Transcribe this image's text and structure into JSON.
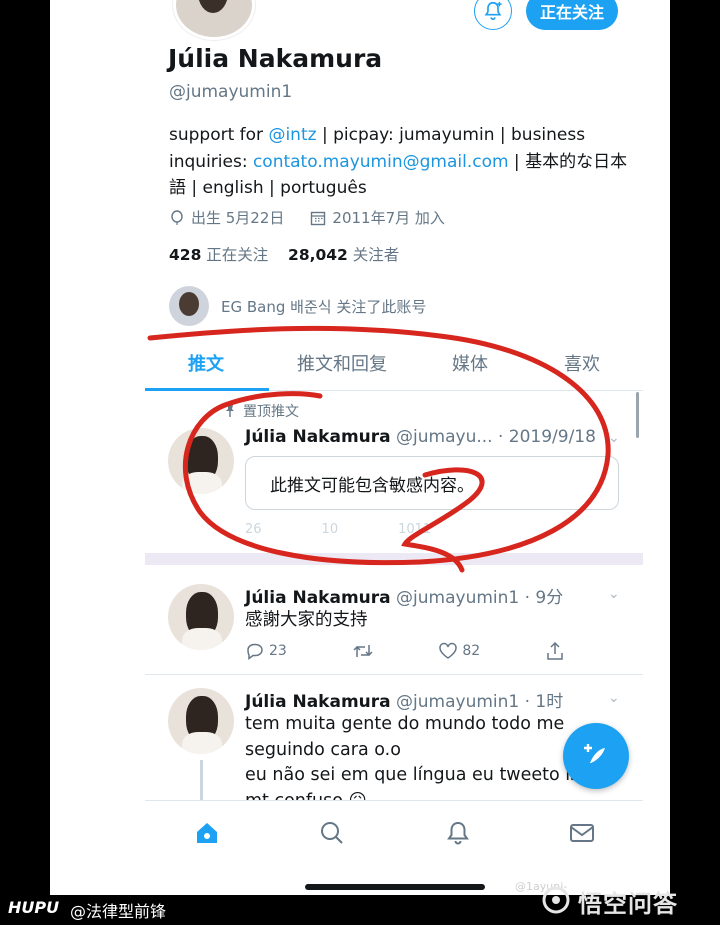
{
  "profile": {
    "follow_label": "正在关注",
    "name": "Júlia Nakamura",
    "handle": "@jumayumin1",
    "bio_parts": {
      "p1": "support for ",
      "link1": "@intz",
      "p2": " | picpay: jumayumin | business inquiries: ",
      "link2": "contato.mayumin@gmail.com",
      "p3": " | 基本的な日本語 | english | português"
    },
    "birthday": "出生 5月22日",
    "joined": "2011年7月 加入",
    "following_count": "428",
    "following_label": "正在关注",
    "followers_count": "28,042",
    "followers_label": "关注者",
    "followed_by": "EG Bang 배준식 关注了此账号"
  },
  "tabs": [
    {
      "label": "推文"
    },
    {
      "label": "推文和回复"
    },
    {
      "label": "媒体"
    },
    {
      "label": "喜欢"
    }
  ],
  "tweets": [
    {
      "pinned_label": "置顶推文",
      "name": "Júlia Nakamura",
      "meta": "@jumayu... · 2019/9/18",
      "sensitive_text": "此推文可能包含敏感内容。",
      "faded_replies": "26",
      "faded_retweets": "10",
      "faded_likes": "1011"
    },
    {
      "name": "Júlia Nakamura",
      "meta": "@jumayumin1 · 9分",
      "text": "感謝大家的支持",
      "replies": "23",
      "likes": "82"
    },
    {
      "name": "Júlia Nakamura",
      "meta": "@jumayumin1 · 1时",
      "text": "tem muita gente do mundo todo me seguindo cara o.o\neu não sei em que língua eu tweeto isso\nmt confuso 😖"
    }
  ],
  "watermark": {
    "source": "HUPU",
    "user": "@法律型前锋",
    "qa": "悟空问答",
    "small": "@1ayuni-"
  },
  "colors": {
    "accent": "#1da1f2",
    "annotation": "#d7261e"
  }
}
